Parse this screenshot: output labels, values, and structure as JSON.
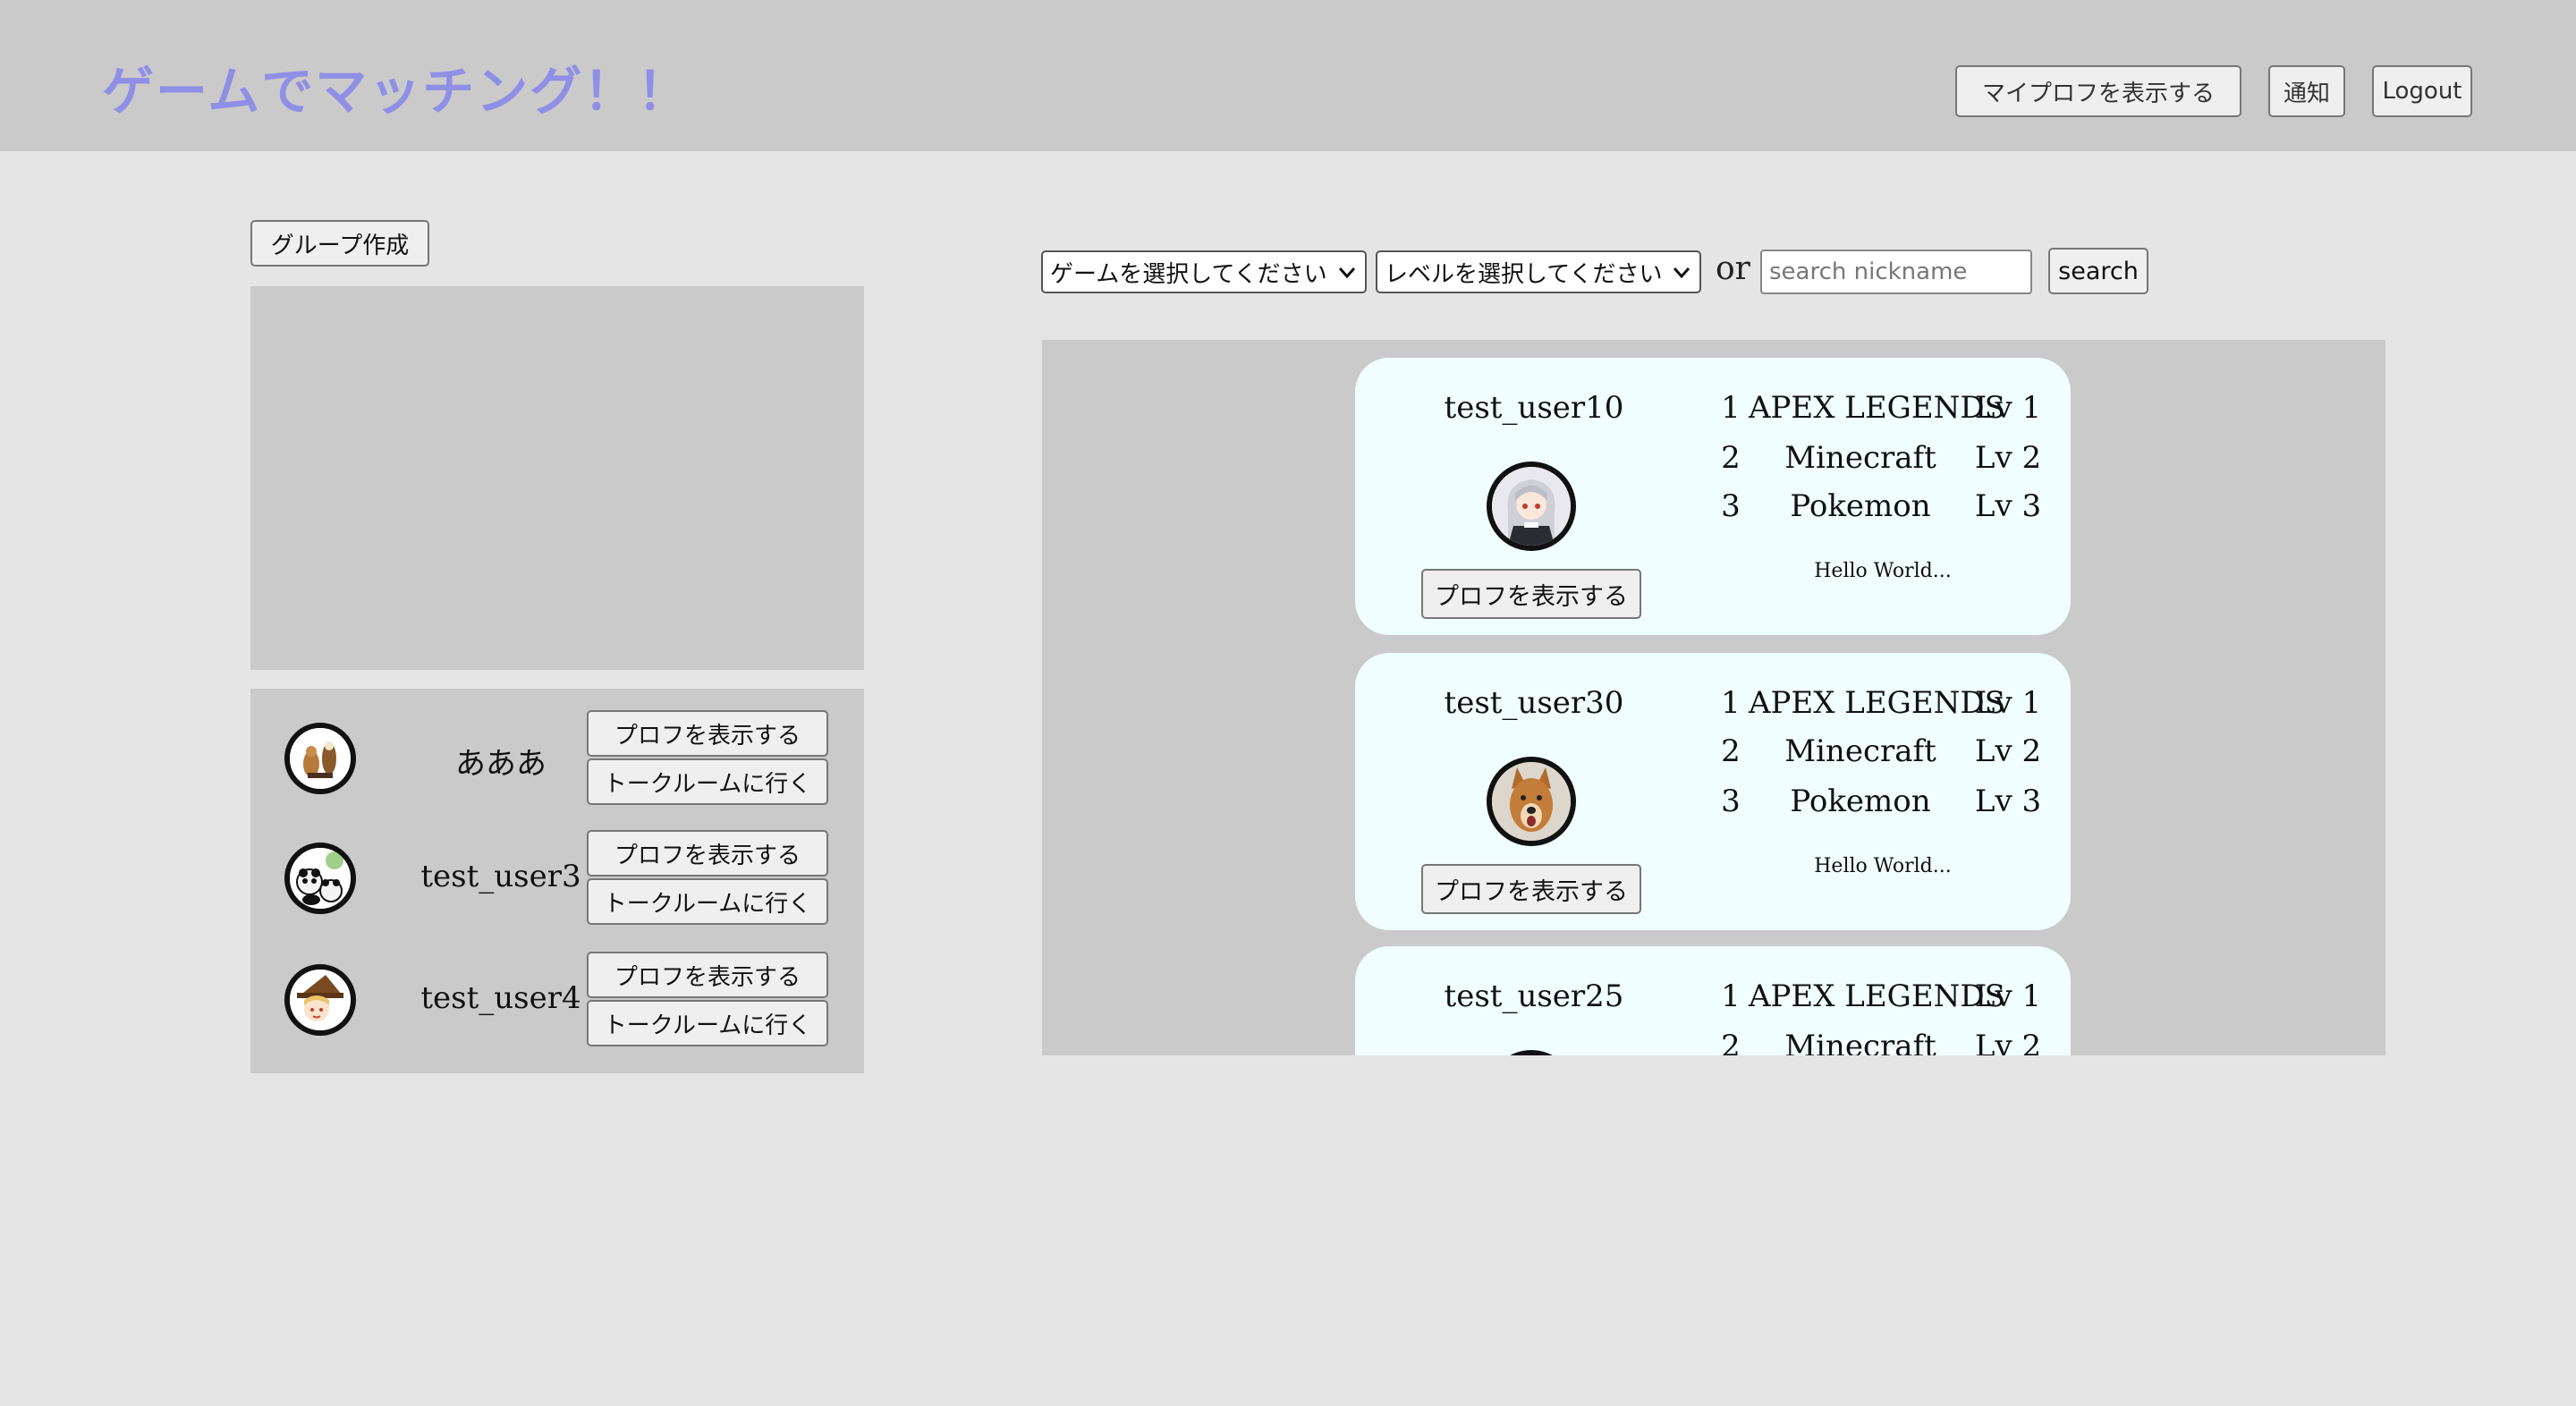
{
  "header": {
    "site_title": "ゲームでマッチング！！",
    "my_profile_label": "マイプロフを表示する",
    "notifications_label": "通知",
    "logout_label": "Logout"
  },
  "left_panel": {
    "group_create_label": "グループ作成",
    "friends": [
      {
        "name": "あああ",
        "avatar_icon": "dogs-avatar-icon",
        "profile_label": "プロフを表示する",
        "talk_label": "トークルームに行く"
      },
      {
        "name": "test_user3",
        "avatar_icon": "panda-avatar-icon",
        "profile_label": "プロフを表示する",
        "talk_label": "トークルームに行く"
      },
      {
        "name": "test_user4",
        "avatar_icon": "witch-avatar-icon",
        "profile_label": "プロフを表示する",
        "talk_label": "トークルームに行く"
      }
    ]
  },
  "search": {
    "game_select_value": "ゲームを選択してください",
    "level_select_value": "レベルを選択してください",
    "or_label": "or",
    "placeholder": "search nickname",
    "button_label": "search"
  },
  "results": [
    {
      "name": "test_user10",
      "avatar_icon": "anime-girl-avatar-icon",
      "profile_label": "プロフを表示する",
      "games": [
        {
          "rank": "1",
          "title": "APEX LEGENDS",
          "level": "Lv 1"
        },
        {
          "rank": "2",
          "title": "Minecraft",
          "level": "Lv 2"
        },
        {
          "rank": "3",
          "title": "Pokemon",
          "level": "Lv 3"
        }
      ],
      "bio": "Hello World..."
    },
    {
      "name": "test_user30",
      "avatar_icon": "dog-avatar-icon",
      "profile_label": "プロフを表示する",
      "games": [
        {
          "rank": "1",
          "title": "APEX LEGENDS",
          "level": "Lv 1"
        },
        {
          "rank": "2",
          "title": "Minecraft",
          "level": "Lv 2"
        },
        {
          "rank": "3",
          "title": "Pokemon",
          "level": "Lv 3"
        }
      ],
      "bio": "Hello World..."
    },
    {
      "name": "test_user25",
      "games": [
        {
          "rank": "1",
          "title": "APEX LEGENDS",
          "level": "Lv 1"
        },
        {
          "rank": "2",
          "title": "Minecraft",
          "level": "Lv 2"
        }
      ]
    }
  ],
  "colors": {
    "header_bg": "#cacaca",
    "page_bg": "#e5e5e5",
    "title_color": "#8f8fe6",
    "card_bg": "#f0fefe"
  }
}
